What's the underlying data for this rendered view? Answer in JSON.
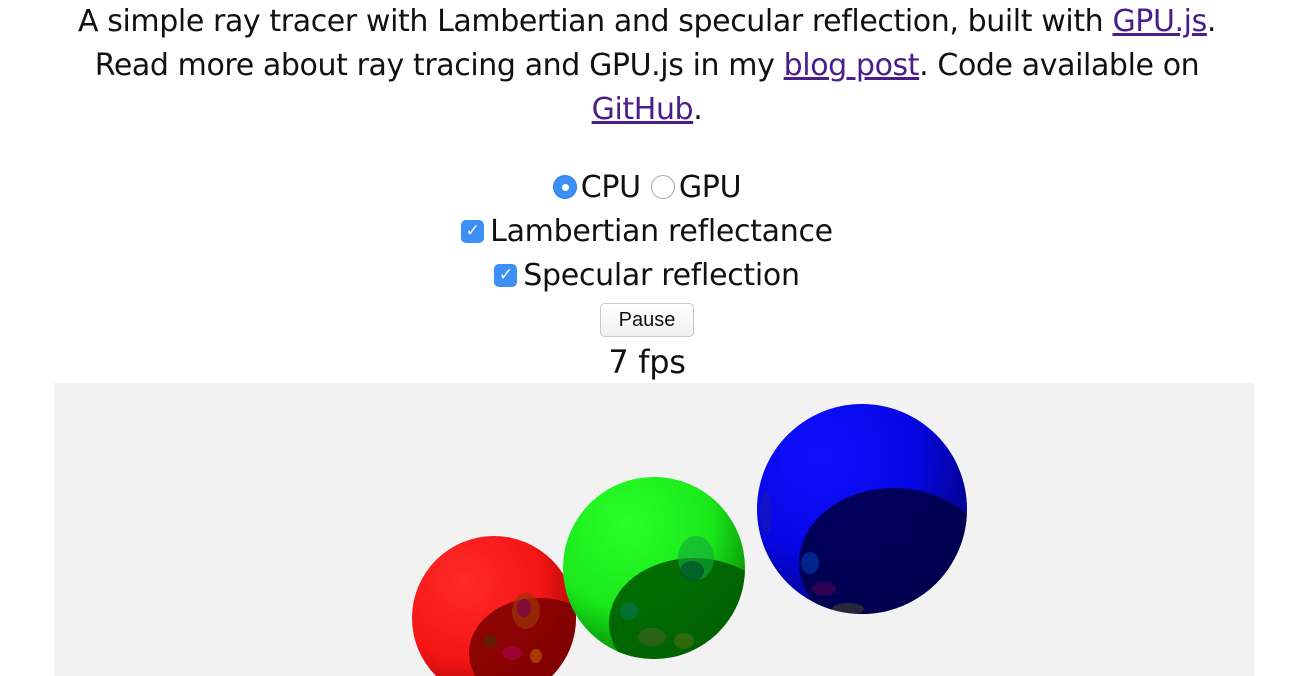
{
  "intro": {
    "line1_prefix": "A simple ray tracer with Lambertian and specular reflection, built with ",
    "gpujs_link": "GPU.js",
    "line1_suffix": ".",
    "line2_prefix": "Read more about ray tracing and GPU.js in my ",
    "blog_link": "blog post",
    "line2_suffix": ". Code available on",
    "github_link": "GitHub",
    "line3_suffix": "."
  },
  "mode": {
    "cpu_label": "CPU",
    "gpu_label": "GPU",
    "selected": "CPU"
  },
  "options": {
    "lambertian_label": "Lambertian reflectance",
    "lambertian_checked": true,
    "specular_label": "Specular reflection",
    "specular_checked": true
  },
  "pause_label": "Pause",
  "fps_label": "7 fps",
  "colors": {
    "link": "#4b1d8a",
    "accent": "#3b8ff6",
    "canvas_bg": "#f2f2f2",
    "sphere_red": "#ff1a1a",
    "sphere_green": "#22ff22",
    "sphere_blue": "#0a0aff"
  }
}
